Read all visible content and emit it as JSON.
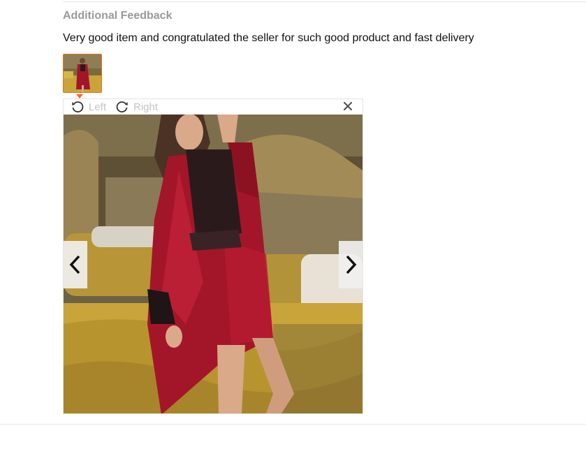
{
  "feedback": {
    "title": "Additional Feedback",
    "text": "Very good item and congratulated the seller for such good product and fast delivery"
  },
  "viewer": {
    "rotate_left_label": "Left",
    "rotate_right_label": "Right",
    "rotate_left_icon": "rotate-left-icon",
    "rotate_right_icon": "rotate-right-icon",
    "close_icon": "close-icon",
    "prev_icon": "chevron-left-icon",
    "next_icon": "chevron-right-icon"
  },
  "colors": {
    "accent": "#f26b1d",
    "title_gray": "#999999",
    "toolbar_text": "#c4c4c4",
    "robe_red": "#a3162a",
    "bedding_gold": "#c9a43a"
  }
}
